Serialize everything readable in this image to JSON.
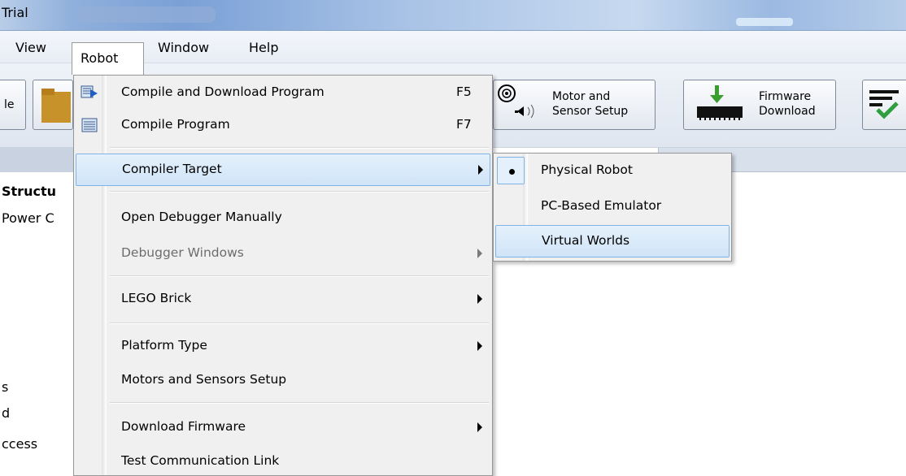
{
  "window": {
    "title": "Trial"
  },
  "menubar": {
    "items": [
      "View",
      "Robot",
      "Window",
      "Help"
    ],
    "open_menu": "Robot"
  },
  "toolbar": {
    "left_partial_label": "le",
    "motor_sensor_setup": {
      "line1": "Motor and",
      "line2": "Sensor Setup"
    },
    "firmware_download": {
      "line1": "Firmware",
      "line2": "Download"
    }
  },
  "left_panel": {
    "lines": [
      "Structu",
      "Power C",
      "s",
      "d",
      "ccess"
    ]
  },
  "robot_menu": {
    "items": [
      {
        "label": "Compile and Download Program",
        "shortcut": "F5",
        "icon": "compile-download-icon"
      },
      {
        "label": "Compile Program",
        "shortcut": "F7",
        "icon": "compile-icon"
      },
      {
        "label": "Compiler Target",
        "submenu": true,
        "highlighted": true
      },
      {
        "label": "Open Debugger Manually"
      },
      {
        "label": "Debugger Windows",
        "submenu": true,
        "disabled": true
      },
      {
        "label": "LEGO Brick",
        "submenu": true
      },
      {
        "label": "Platform Type",
        "submenu": true
      },
      {
        "label": "Motors and Sensors Setup"
      },
      {
        "label": "Download Firmware",
        "submenu": true
      },
      {
        "label": "Test Communication Link"
      }
    ]
  },
  "compiler_target_submenu": {
    "items": [
      {
        "label": "Physical Robot",
        "checked": true
      },
      {
        "label": "PC-Based Emulator"
      },
      {
        "label": "Virtual Worlds",
        "highlighted": true
      }
    ]
  },
  "colors": {
    "highlight_border": "#7fb3e6",
    "highlight_fill": "#cfe4f8",
    "disabled_text": "#6d6d6d",
    "menu_bg": "#f0f0f0"
  }
}
